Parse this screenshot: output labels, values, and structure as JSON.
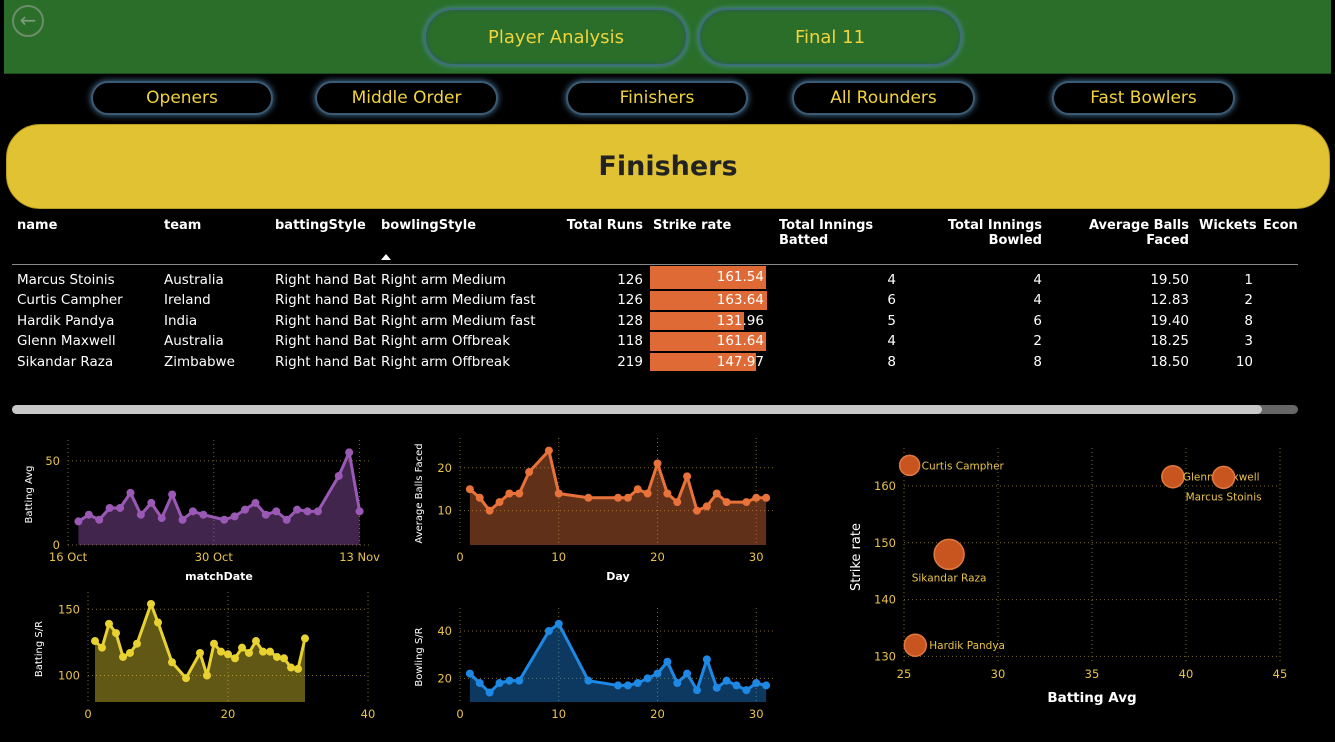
{
  "header": {
    "back_icon": "back-arrow-icon",
    "tabs": [
      "Player Analysis",
      "Final 11"
    ]
  },
  "nav": [
    "Openers",
    "Middle Order",
    "Finishers",
    "All Rounders",
    "Fast Bowlers"
  ],
  "banner": {
    "title": "Finishers"
  },
  "colors": {
    "topbar": "#2a6e2a",
    "accent": "#f1d33b",
    "banner": "#e1c232",
    "bar": "#e06a36"
  },
  "table": {
    "columns": [
      "name",
      "team",
      "battingStyle",
      "bowlingStyle",
      "Total Runs",
      "Strike rate",
      "Total Innings Batted",
      "Total Innings Bowled",
      "Average Balls Faced",
      "Wickets",
      "Econ"
    ],
    "sorted_column": "bowlingStyle",
    "rows": [
      {
        "name": "Marcus Stoinis",
        "team": "Australia",
        "batting": "Right hand Bat",
        "bowling": "Right arm Medium",
        "runs": "126",
        "sr": "161.54",
        "inn_bat": "4",
        "inn_bowl": "4",
        "abf": "19.50",
        "wkts": "1"
      },
      {
        "name": "Curtis Campher",
        "team": "Ireland",
        "batting": "Right hand Bat",
        "bowling": "Right arm Medium fast",
        "runs": "126",
        "sr": "163.64",
        "inn_bat": "6",
        "inn_bowl": "4",
        "abf": "12.83",
        "wkts": "2"
      },
      {
        "name": "Hardik Pandya",
        "team": "India",
        "batting": "Right hand Bat",
        "bowling": "Right arm Medium fast",
        "runs": "128",
        "sr": "131.96",
        "inn_bat": "5",
        "inn_bowl": "6",
        "abf": "19.40",
        "wkts": "8"
      },
      {
        "name": "Glenn Maxwell",
        "team": "Australia",
        "batting": "Right hand Bat",
        "bowling": "Right arm Offbreak",
        "runs": "118",
        "sr": "161.64",
        "inn_bat": "4",
        "inn_bowl": "2",
        "abf": "18.25",
        "wkts": "3"
      },
      {
        "name": "Sikandar Raza",
        "team": "Zimbabwe",
        "batting": "Right hand Bat",
        "bowling": "Right arm Offbreak",
        "runs": "219",
        "sr": "147.97",
        "inn_bat": "8",
        "inn_bowl": "8",
        "abf": "18.50",
        "wkts": "10"
      }
    ],
    "sr_scale_max": 165
  },
  "chart_data": [
    {
      "type": "area",
      "color": "#9b59b6",
      "xlabel": "matchDate",
      "ylabel": "Batting Avg",
      "xlim": [
        0,
        29
      ],
      "ylim": [
        0,
        60
      ],
      "x_ticks": [
        {
          "v": 0,
          "label": "16 Oct"
        },
        {
          "v": 14,
          "label": "30 Oct"
        },
        {
          "v": 28,
          "label": "13 Nov"
        }
      ],
      "y_ticks": [
        0,
        50
      ],
      "x": [
        1,
        2,
        3,
        4,
        5,
        6,
        7,
        8,
        9,
        10,
        11,
        12,
        13,
        15,
        16,
        17,
        18,
        19,
        20,
        21,
        22,
        23,
        24,
        26,
        27,
        28
      ],
      "y": [
        14,
        18,
        15,
        22,
        22,
        31,
        18,
        25,
        16,
        30,
        15,
        20,
        18,
        15,
        17,
        21,
        25,
        18,
        20,
        15,
        21,
        20,
        20,
        41,
        55,
        20
      ]
    },
    {
      "type": "area",
      "color": "#e8723a",
      "xlabel": "Day",
      "ylabel": "Average Balls Faced",
      "xlim": [
        0,
        32
      ],
      "ylim": [
        2,
        26
      ],
      "x_ticks": [
        0,
        10,
        20,
        30
      ],
      "y_ticks": [
        10,
        20
      ],
      "x": [
        1,
        2,
        3,
        4,
        5,
        6,
        7,
        9,
        10,
        13,
        16,
        17,
        18,
        19,
        20,
        21,
        22,
        23,
        24,
        25,
        26,
        27,
        29,
        30,
        31
      ],
      "y": [
        15,
        13,
        10,
        12,
        14,
        14,
        19,
        24,
        14,
        13,
        13,
        13,
        15,
        14,
        21,
        14,
        12,
        18,
        10,
        11,
        14,
        12,
        12,
        13,
        13
      ]
    },
    {
      "type": "area",
      "color": "#e8d232",
      "xlabel": "",
      "ylabel": "Batting S/R",
      "xlim": [
        0,
        40
      ],
      "ylim": [
        80,
        160
      ],
      "x_ticks": [
        0,
        20,
        40
      ],
      "y_ticks": [
        100,
        150
      ],
      "x": [
        1,
        2,
        3,
        4,
        5,
        6,
        7,
        9,
        10,
        12,
        14,
        16,
        17,
        18,
        19,
        20,
        21,
        22,
        23,
        24,
        25,
        26,
        27,
        28,
        29,
        30,
        31
      ],
      "y": [
        126,
        121,
        139,
        132,
        114,
        117,
        124,
        154,
        140,
        110,
        98,
        117,
        100,
        124,
        118,
        116,
        113,
        121,
        117,
        126,
        118,
        118,
        114,
        113,
        106,
        105,
        128
      ]
    },
    {
      "type": "area",
      "color": "#1e88e5",
      "xlabel": "",
      "ylabel": "Bowling S/R",
      "xlim": [
        0,
        32
      ],
      "ylim": [
        10,
        48
      ],
      "x_ticks": [
        0,
        10,
        20,
        30
      ],
      "y_ticks": [
        20,
        40
      ],
      "x": [
        1,
        2,
        3,
        4,
        5,
        6,
        9,
        10,
        13,
        16,
        17,
        18,
        19,
        20,
        21,
        22,
        23,
        24,
        25,
        26,
        27,
        28,
        29,
        30,
        31
      ],
      "y": [
        22,
        18,
        14,
        18,
        19,
        19,
        40,
        43,
        19,
        17,
        17,
        18,
        20,
        22,
        27,
        18,
        22,
        15,
        28,
        16,
        19,
        17,
        15,
        18,
        17
      ]
    },
    {
      "type": "scatter",
      "color": "#c8541f",
      "xlabel": "Batting Avg",
      "ylabel": "Strike rate",
      "xlim": [
        25,
        45
      ],
      "ylim": [
        129,
        166
      ],
      "x_ticks": [
        25,
        30,
        35,
        40,
        45
      ],
      "y_ticks": [
        130,
        140,
        150,
        160
      ],
      "points": [
        {
          "label": "Curtis Campher",
          "x": 25.3,
          "y": 163.64,
          "size": 10
        },
        {
          "label": "Glenn Maxwell",
          "x": 39.3,
          "y": 161.64,
          "size": 11
        },
        {
          "label": "Marcus Stoinis",
          "x": 42.0,
          "y": 161.54,
          "size": 11
        },
        {
          "label": "Sikandar Raza",
          "x": 27.4,
          "y": 147.97,
          "size": 15
        },
        {
          "label": "Hardik Pandya",
          "x": 25.6,
          "y": 131.96,
          "size": 11
        }
      ]
    }
  ]
}
